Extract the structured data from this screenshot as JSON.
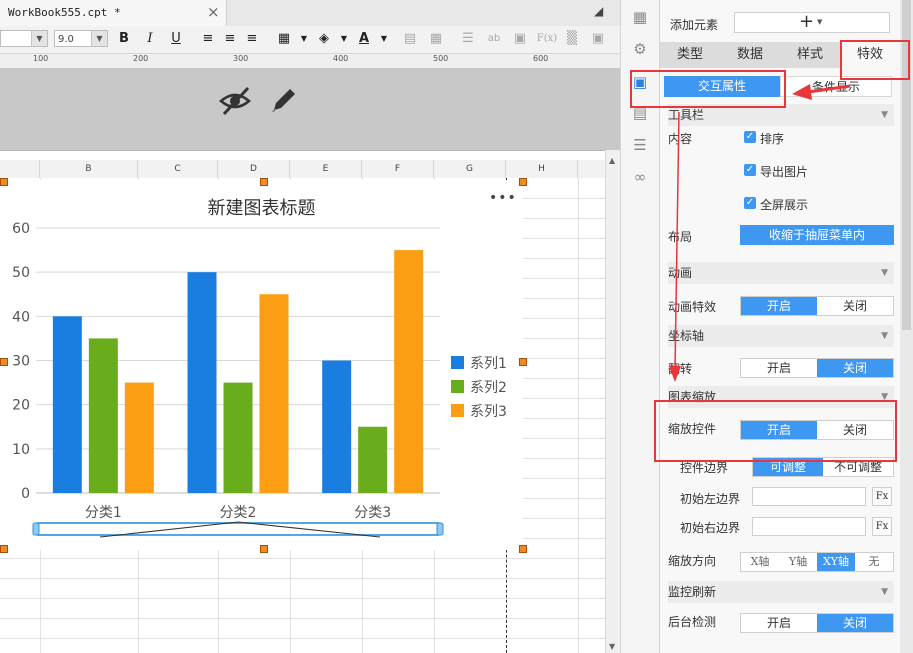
{
  "editor": {
    "tab_label": "WorkBook555.cpt *",
    "close_glyph": "×",
    "font_size": "9.0",
    "bold": "B",
    "italic": "I",
    "underline": "U",
    "text_color_glyph": "A",
    "ab_glyph": "ab",
    "fx_glyph": "F(x)",
    "ruler": [
      "100",
      "200",
      "300",
      "400",
      "500",
      "600"
    ],
    "columns": [
      "B",
      "C",
      "D",
      "E",
      "F",
      "G",
      "H"
    ]
  },
  "chart_data": {
    "type": "bar",
    "title": "新建图表标题",
    "more": "•••",
    "categories": [
      "分类1",
      "分类2",
      "分类3"
    ],
    "series": [
      {
        "name": "系列1",
        "values": [
          40,
          50,
          30
        ],
        "color": "#1a7ee0"
      },
      {
        "name": "系列2",
        "values": [
          35,
          25,
          15
        ],
        "color": "#6aad1c"
      },
      {
        "name": "系列3",
        "values": [
          25,
          45,
          55
        ],
        "color": "#fb9e13"
      }
    ],
    "ylim": [
      0,
      60
    ],
    "yticks": [
      "0",
      "10",
      "20",
      "30",
      "40",
      "50",
      "60"
    ],
    "grid": true,
    "legend_position": "right"
  },
  "panel": {
    "add_element_label": "添加元素",
    "add_glyph": "+",
    "tabs": [
      "类型",
      "数据",
      "样式",
      "特效"
    ],
    "subtabs": [
      "交互属性",
      "条件显示"
    ],
    "toolbar_section": "工具栏",
    "content_label": "内容",
    "checkbox_items": [
      "排序",
      "导出图片",
      "全屏展示"
    ],
    "layout_label": "布局",
    "layout_value": "收缩于抽屉菜单内",
    "animation_section": "动画",
    "animation_effect_label": "动画特效",
    "axis_section": "坐标轴",
    "flip_label": "翻转",
    "zoom_section": "图表缩放",
    "zoom_control_label": "缩放控件",
    "control_border_label": "控件边界",
    "border_options": [
      "可调整",
      "不可调整"
    ],
    "init_left_label": "初始左边界",
    "init_right_label": "初始右边界",
    "fx_label": "Fx",
    "zoom_dir_label": "缩放方向",
    "zoom_dir_options": [
      "X轴",
      "Y轴",
      "XY轴",
      "无"
    ],
    "monitor_section": "监控刷新",
    "bg_check_label": "后台检测",
    "on_label": "开启",
    "off_label": "关闭"
  },
  "colors": {
    "accent": "#3e97f1",
    "annotation": "#e8363a"
  }
}
